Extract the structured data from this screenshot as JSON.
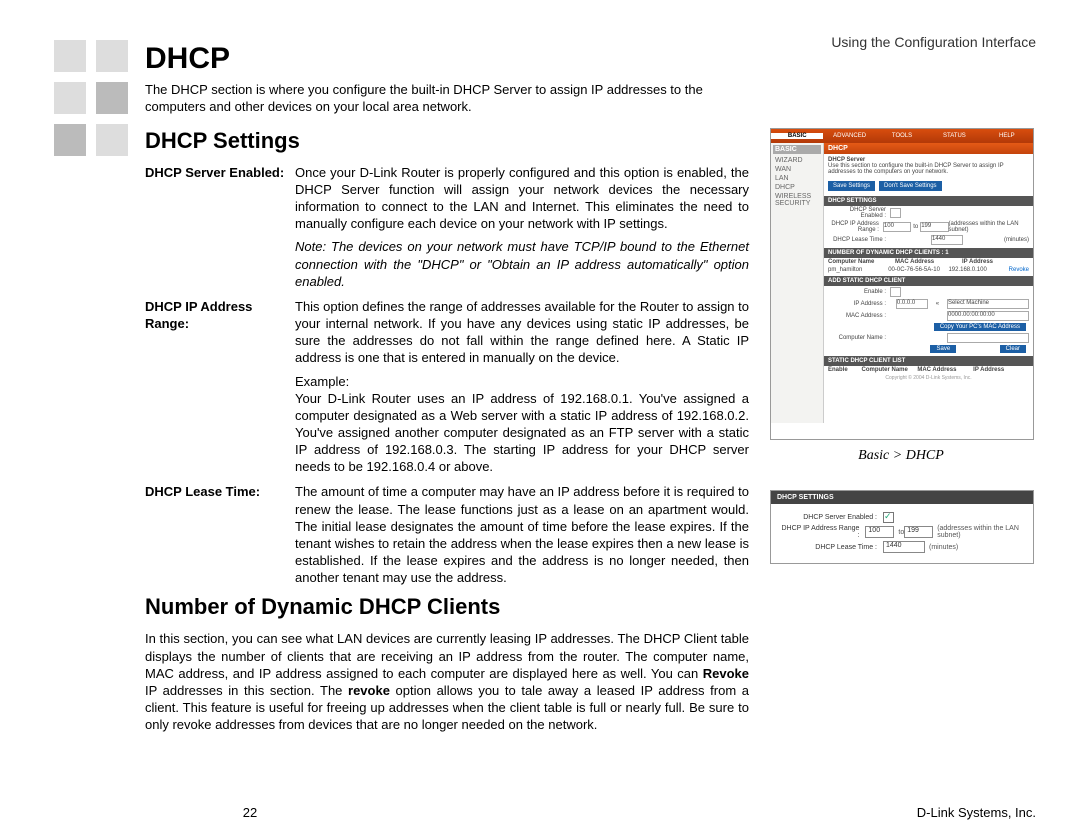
{
  "header": {
    "section_label": "Using the Configuration Interface"
  },
  "title": "DHCP",
  "intro": "The DHCP section is where you configure the built-in DHCP Server to assign IP addresses to the computers and other devices on your local area network.",
  "subtitle_settings": "DHCP Settings",
  "defs": {
    "server_enabled": {
      "label": "DHCP Server Enabled:",
      "body": "Once your D-Link Router is properly configured and this option is enabled, the DHCP Server function will assign your network devices the necessary information to connect to the LAN and Internet. This eliminates the need to manually configure each device on your network with IP settings.",
      "note": "Note: The devices on your network must have TCP/IP bound to the Ethernet connection with the \"DHCP\" or \"Obtain an IP address automatically\" option enabled."
    },
    "ip_range": {
      "label": "DHCP IP Address Range:",
      "body": "This option defines the range of addresses available for the Router to assign to your internal network. If you have any devices using static IP addresses, be sure the addresses do not fall within the range defined here. A Static IP address is one that is entered in manually on the device.",
      "example_label": "Example:",
      "example_body": "Your D-Link Router uses an IP address of 192.168.0.1. You've assigned a computer designated as a Web server with a static IP address of 192.168.0.2. You've assigned another computer designated as an FTP server with a static IP address of 192.168.0.3. The starting IP address for your DHCP server needs to be 192.168.0.4 or above."
    },
    "lease_time": {
      "label": "DHCP Lease Time:",
      "body": "The amount of time a computer may have an IP address before it is required to renew the lease. The lease functions just as a lease on an apartment would. The initial lease designates the amount of time before the lease expires. If the tenant wishes to retain the address when the lease expires then a new lease is established. If the lease expires and the address is no longer needed, then another tenant may use the address."
    }
  },
  "subtitle_clients": "Number of Dynamic DHCP Clients",
  "clients_para_1": "In this section, you can see what LAN devices are currently leasing IP addresses. The DHCP Client table displays the number of clients that are receiving an IP address from the router. The computer name, MAC address, and IP address assigned to each computer are displayed here as well. You can ",
  "clients_bold_1": "Revoke",
  "clients_para_2": " IP addresses in this section. The ",
  "clients_bold_2": "revoke",
  "clients_para_3": " option allows you to tale away a leased IP address from a client. This feature is useful for freeing up addresses when the client table is full or nearly full. Be sure to only revoke addresses from devices that are no longer needed on the network.",
  "page_number": "22",
  "footer_company": "D-Link Systems, Inc.",
  "figure1": {
    "tabs": [
      "BASIC",
      "ADVANCED",
      "TOOLS",
      "STATUS",
      "HELP"
    ],
    "side_head": "BASIC",
    "side_items": [
      "WIZARD",
      "WAN",
      "LAN",
      "DHCP",
      "WIRELESS SECURITY"
    ],
    "panel_title": "DHCP",
    "panel_sub": "DHCP Server",
    "panel_desc": "Use this section to configure the built-in DHCP Server to assign IP addresses to the computers on your network.",
    "btn_save": "Save Settings",
    "btn_cancel": "Don't Save Settings",
    "bar_settings": "DHCP SETTINGS",
    "row_enabled": "DHCP Server Enabled :",
    "row_range": "DHCP IP Address Range :",
    "row_range_from": "100",
    "row_range_to": "199",
    "row_range_note": "(addresses within the LAN subnet)",
    "row_lease": "DHCP Lease Time :",
    "row_lease_val": "1440",
    "row_lease_unit": "(minutes)",
    "bar_clients": "NUMBER OF DYNAMIC DHCP CLIENTS : 1",
    "client_cols": [
      "Computer Name",
      "MAC Address",
      "IP Address"
    ],
    "client_row": [
      "pm_hamilton",
      "00-0C-76-56-5A-10",
      "192.168.0.100",
      "Revoke"
    ],
    "bar_add": "ADD STATIC DHCP CLIENT",
    "add_enable": "Enable :",
    "add_ip": "IP Address :",
    "add_ip_val": "0.0.0.0",
    "add_ip_sel": "Select Machine",
    "add_mac": "MAC Address :",
    "add_mac_val": "0000.00:00:00:00",
    "add_copy": "Copy Your PC's MAC Address",
    "add_cname": "Computer Name :",
    "btn_save2": "Save",
    "btn_clear": "Clear",
    "bar_list": "STATIC DHCP CLIENT LIST",
    "list_cols": [
      "Enable",
      "Computer Name",
      "MAC Address",
      "IP Address"
    ],
    "copyright": "Copyright © 2004 D-Link Systems, Inc."
  },
  "figure1_caption": "Basic > DHCP",
  "figure2": {
    "bar": "DHCP SETTINGS",
    "row_enabled": "DHCP Server Enabled :",
    "row_range": "DHCP IP Address Range :",
    "row_range_from": "100",
    "row_range_to": "199",
    "row_range_note": "(addresses within the LAN subnet)",
    "row_lease": "DHCP Lease Time :",
    "row_lease_val": "1440",
    "row_lease_unit": "(minutes)"
  }
}
